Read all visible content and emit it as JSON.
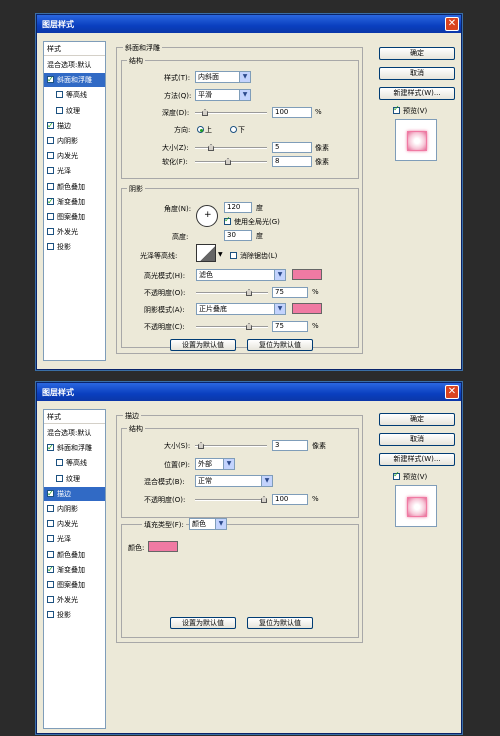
{
  "dialog1": {
    "title": "图层样式",
    "styles": {
      "header": "样式",
      "items": [
        {
          "label": "混合选项:默认"
        },
        {
          "label": "斜面和浮雕",
          "checked": true,
          "selected": true
        },
        {
          "label": "等高线",
          "checked": false,
          "sub": true
        },
        {
          "label": "纹理",
          "checked": false,
          "sub": true
        },
        {
          "label": "描边",
          "checked": true
        },
        {
          "label": "内阴影",
          "checked": false
        },
        {
          "label": "内发光",
          "checked": false
        },
        {
          "label": "光泽",
          "checked": false
        },
        {
          "label": "颜色叠加",
          "checked": false
        },
        {
          "label": "渐变叠加",
          "checked": true
        },
        {
          "label": "图案叠加",
          "checked": false
        },
        {
          "label": "外发光",
          "checked": false
        },
        {
          "label": "投影",
          "checked": false
        }
      ]
    },
    "section_title": "斜面和浮雕",
    "structure": {
      "title": "结构",
      "style_label": "样式(T):",
      "style_value": "内斜面",
      "method_label": "方法(Q):",
      "method_value": "平滑",
      "depth_label": "深度(D):",
      "depth_value": "100",
      "depth_unit": "%",
      "depth_level": 0.1,
      "direction_label": "方向:",
      "dir_up": "上",
      "dir_down": "下",
      "size_label": "大小(Z):",
      "size_value": "5",
      "size_unit": "像素",
      "size_level": 0.2,
      "soften_label": "软化(F):",
      "soften_value": "8",
      "soften_unit": "像素",
      "soften_level": 0.45
    },
    "shading": {
      "title": "阴影",
      "angle_label": "角度(N):",
      "angle_value": "120",
      "angle_unit": "度",
      "global_light_label": "使用全局光(G)",
      "altitude_label": "高度:",
      "altitude_value": "30",
      "altitude_unit": "度",
      "gloss_label": "光泽等高线:",
      "anti_alias_label": "消除锯齿(L)",
      "highlight_label": "高光模式(H):",
      "highlight_value": "滤色",
      "highlight_color": "#f07aa3",
      "opacity1_label": "不透明度(O):",
      "opacity1_value": "75",
      "opacity1_unit": "%",
      "opacity1_level": 0.75,
      "shadow_label": "阴影模式(A):",
      "shadow_value": "正片叠底",
      "shadow_color": "#f07aa3",
      "opacity2_label": "不透明度(C):",
      "opacity2_value": "75",
      "opacity2_unit": "%",
      "opacity2_level": 0.75
    },
    "set_default": "设置为默认值",
    "reset_default": "复位为默认值",
    "buttons": {
      "ok": "确定",
      "cancel": "取消",
      "new_style": "新建样式(W)...",
      "preview": "预览(V)"
    }
  },
  "dialog2": {
    "title": "图层样式",
    "styles": {
      "header": "样式",
      "items": [
        {
          "label": "混合选项:默认"
        },
        {
          "label": "斜面和浮雕",
          "checked": true
        },
        {
          "label": "等高线",
          "checked": false,
          "sub": true
        },
        {
          "label": "纹理",
          "checked": false,
          "sub": true
        },
        {
          "label": "描边",
          "checked": true,
          "selected": true
        },
        {
          "label": "内阴影",
          "checked": false
        },
        {
          "label": "内发光",
          "checked": false
        },
        {
          "label": "光泽",
          "checked": false
        },
        {
          "label": "颜色叠加",
          "checked": false
        },
        {
          "label": "渐变叠加",
          "checked": true
        },
        {
          "label": "图案叠加",
          "checked": false
        },
        {
          "label": "外发光",
          "checked": false
        },
        {
          "label": "投影",
          "checked": false
        }
      ]
    },
    "section_title": "描边",
    "structure": {
      "title": "结构",
      "size_label": "大小(S):",
      "size_value": "3",
      "size_unit": "像素",
      "size_level": 0.05,
      "position_label": "位置(P):",
      "position_value": "外部",
      "blend_label": "混合模式(B):",
      "blend_value": "正常",
      "opacity_label": "不透明度(O):",
      "opacity_value": "100",
      "opacity_unit": "%",
      "opacity_level": 1.0
    },
    "fill_type_label": "填充类型(F):",
    "fill_type_value": "颜色",
    "color_label": "颜色:",
    "color_value": "#f07aa3",
    "set_default": "设置为默认值",
    "reset_default": "复位为默认值",
    "buttons": {
      "ok": "确定",
      "cancel": "取消",
      "new_style": "新建样式(W)...",
      "preview": "预览(V)"
    }
  }
}
